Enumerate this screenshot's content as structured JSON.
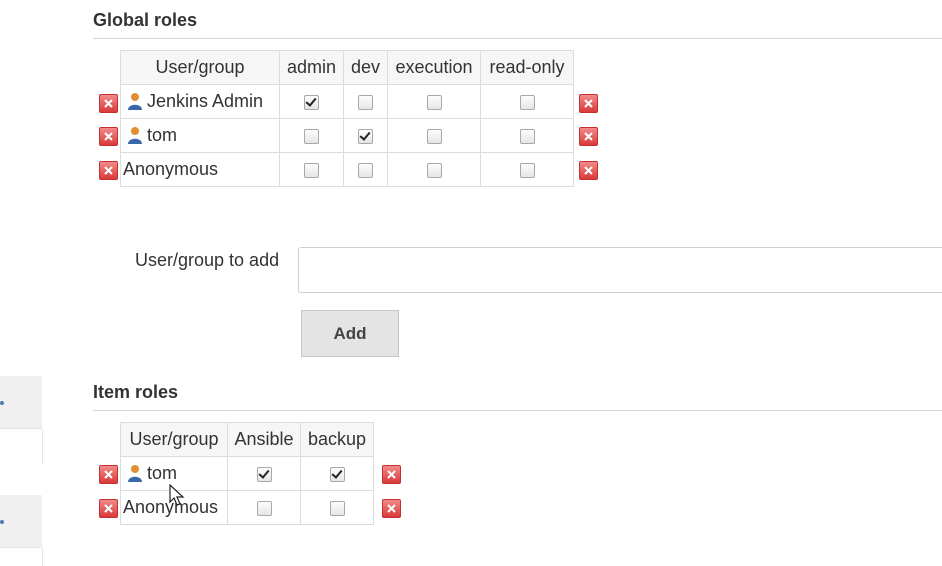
{
  "global_roles": {
    "title": "Global roles",
    "headers": [
      "User/group",
      "admin",
      "dev",
      "execution",
      "read-only"
    ],
    "rows": [
      {
        "name": "Jenkins Admin",
        "icon": "user-icon",
        "checks": [
          true,
          false,
          false,
          false
        ]
      },
      {
        "name": "tom",
        "icon": "user-icon",
        "checks": [
          false,
          true,
          false,
          false
        ]
      },
      {
        "name": "Anonymous",
        "icon": null,
        "checks": [
          false,
          false,
          false,
          false
        ]
      }
    ]
  },
  "add_user": {
    "label": "User/group to add",
    "input_value": "",
    "button_label": "Add"
  },
  "item_roles": {
    "title": "Item roles",
    "headers": [
      "User/group",
      "Ansible",
      "backup"
    ],
    "rows": [
      {
        "name": "tom",
        "icon": "user-icon",
        "checks": [
          true,
          true
        ]
      },
      {
        "name": "Anonymous",
        "icon": null,
        "checks": [
          false,
          false
        ]
      }
    ]
  },
  "colors": {
    "delete_icon": "#d93a3a",
    "header_bg": "#f6f6f6",
    "user_icon_blue": "#3b66a8",
    "user_icon_orange": "#e0902e"
  }
}
